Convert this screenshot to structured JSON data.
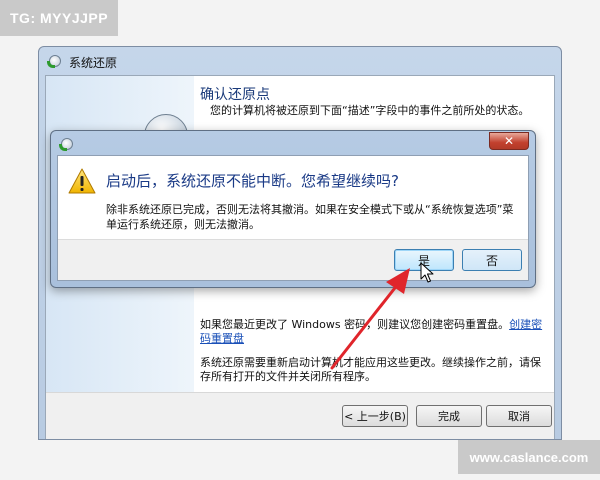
{
  "watermarks": {
    "top": "TG: MYYJJPP",
    "bottom": "www.caslance.com"
  },
  "main_window": {
    "title": "系统还原",
    "heading": "确认还原点",
    "description": "您的计算机将被还原到下面“描述”字段中的事件之前所处的状态。",
    "password_note_prefix": "如果您最近更改了 Windows 密码，则建议您创建密码重置盘。",
    "password_note_link": "创建密码重置盘",
    "restart_note": "系统还原需要重新启动计算机才能应用这些更改。继续操作之前，请保存所有打开的文件并关闭所有程序。",
    "buttons": {
      "back": "< 上一步(B)",
      "finish": "完成",
      "cancel": "取消"
    }
  },
  "dialog": {
    "close_label": "✕",
    "heading": "启动后，系统还原不能中断。您希望继续吗?",
    "body": "除非系统还原已完成，否则无法将其撤消。如果在安全模式下或从“系统恢复选项”菜单运行系统还原，则无法撤消。",
    "buttons": {
      "yes": "是",
      "no": "否"
    }
  },
  "colors": {
    "heading_blue": "#1a3a86",
    "arrow_red": "#e0252b",
    "close_red": "#c2402e"
  },
  "icons": [
    "system-restore-icon",
    "warning-icon",
    "close-icon",
    "mouse-cursor-icon",
    "red-arrow-annotation"
  ]
}
